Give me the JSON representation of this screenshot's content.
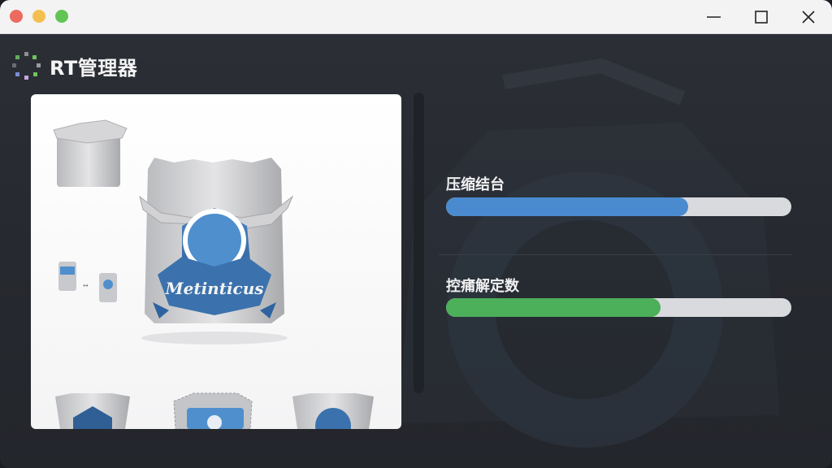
{
  "window": {
    "title_controls": {
      "minimize": "minimize-icon",
      "maximize": "maximize-icon",
      "close": "close-icon"
    }
  },
  "app": {
    "title": "RT管理器"
  },
  "preview": {
    "package_label": "Metinticus"
  },
  "tasks": [
    {
      "label": "压缩结台",
      "progress": 0.7,
      "color": "#4a8bd0"
    },
    {
      "label": "控痡解定数",
      "progress": 0.62,
      "color": "#4caf5a"
    }
  ],
  "colors": {
    "accent_blue": "#4a8bd0",
    "accent_green": "#4caf5a",
    "background": "#2a2d33"
  }
}
